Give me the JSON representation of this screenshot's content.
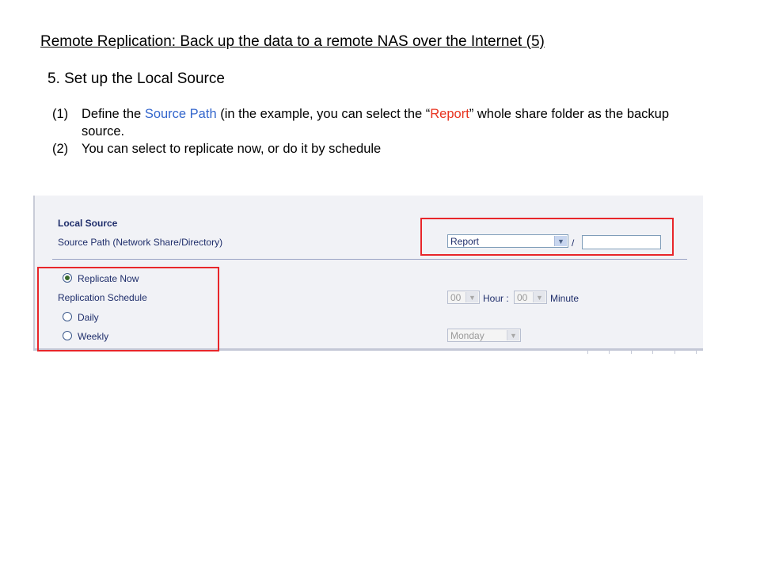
{
  "slide": {
    "title": "Remote Replication: Back up the data to a remote NAS over the Internet (5)",
    "step": "5. Set up the Local Source",
    "instructions": [
      {
        "num": "(1)",
        "pre": "Define the ",
        "highlight1": "Source Path",
        "mid": " (in the example, you can select the “",
        "highlight2": "Report",
        "post": "” whole share folder as the backup source."
      },
      {
        "num": "(2)",
        "text": "You can select to replicate now, or do it by schedule"
      }
    ]
  },
  "ui": {
    "section_title": "Local Source",
    "source_path_label": "Source Path (Network Share/Directory)",
    "share_select_value": "Report",
    "path_separator": "/",
    "directory_value": "",
    "replicate_now_label": "Replicate Now",
    "replication_schedule_label": "Replication Schedule",
    "daily_label": "Daily",
    "weekly_label": "Weekly",
    "hour_value": "00",
    "hour_label": "Hour :",
    "minute_value": "00",
    "minute_label": "Minute",
    "weekday_value": "Monday",
    "selected_option": "Replicate Now"
  },
  "colors": {
    "source_path_highlight": "#3366cc",
    "report_highlight": "#e8321e",
    "annotation_box": "#e8262a",
    "panel_background": "#f1f2f6",
    "panel_text": "#1f2e6b"
  },
  "icons": {
    "dropdown_arrow": "chevron-down-icon",
    "radio_selected": "radio-selected-icon",
    "radio_unselected": "radio-unselected-icon"
  }
}
